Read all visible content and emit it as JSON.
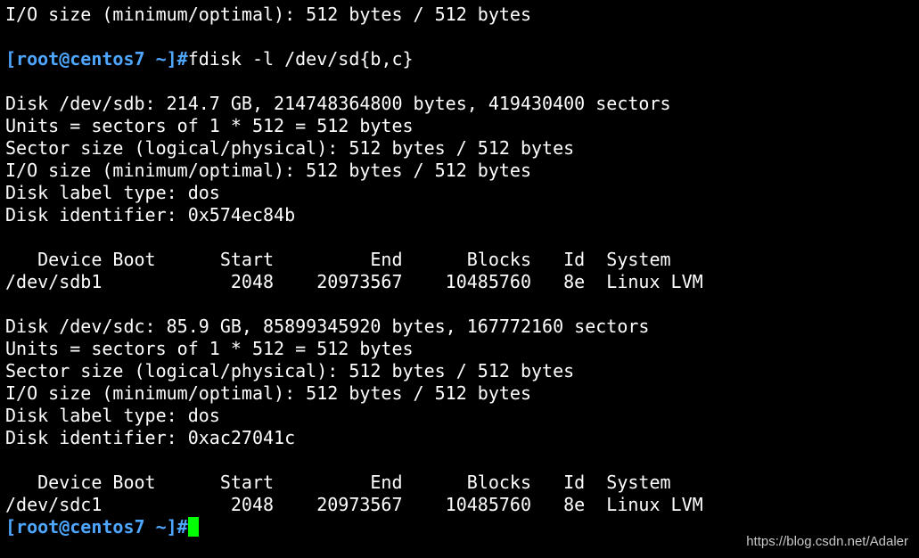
{
  "terminal": {
    "lines": [
      {
        "type": "output",
        "text": "I/O size (minimum/optimal): 512 bytes / 512 bytes"
      },
      {
        "type": "blank",
        "text": ""
      },
      {
        "type": "prompt",
        "prompt": "[root@centos7 ~]#",
        "command": "fdisk -l /dev/sd{b,c}"
      },
      {
        "type": "blank",
        "text": ""
      },
      {
        "type": "output",
        "text": "Disk /dev/sdb: 214.7 GB, 214748364800 bytes, 419430400 sectors"
      },
      {
        "type": "output",
        "text": "Units = sectors of 1 * 512 = 512 bytes"
      },
      {
        "type": "output",
        "text": "Sector size (logical/physical): 512 bytes / 512 bytes"
      },
      {
        "type": "output",
        "text": "I/O size (minimum/optimal): 512 bytes / 512 bytes"
      },
      {
        "type": "output",
        "text": "Disk label type: dos"
      },
      {
        "type": "output",
        "text": "Disk identifier: 0x574ec84b"
      },
      {
        "type": "blank",
        "text": ""
      },
      {
        "type": "output",
        "text": "   Device Boot      Start         End      Blocks   Id  System"
      },
      {
        "type": "output",
        "text": "/dev/sdb1            2048    20973567    10485760   8e  Linux LVM"
      },
      {
        "type": "blank",
        "text": ""
      },
      {
        "type": "output",
        "text": "Disk /dev/sdc: 85.9 GB, 85899345920 bytes, 167772160 sectors"
      },
      {
        "type": "output",
        "text": "Units = sectors of 1 * 512 = 512 bytes"
      },
      {
        "type": "output",
        "text": "Sector size (logical/physical): 512 bytes / 512 bytes"
      },
      {
        "type": "output",
        "text": "I/O size (minimum/optimal): 512 bytes / 512 bytes"
      },
      {
        "type": "output",
        "text": "Disk label type: dos"
      },
      {
        "type": "output",
        "text": "Disk identifier: 0xac27041c"
      },
      {
        "type": "blank",
        "text": ""
      },
      {
        "type": "output",
        "text": "   Device Boot      Start         End      Blocks   Id  System"
      },
      {
        "type": "output",
        "text": "/dev/sdc1            2048    20973567    10485760   8e  Linux LVM"
      },
      {
        "type": "prompt",
        "prompt": "[root@centos7 ~]#",
        "command": "",
        "cursor": true
      }
    ],
    "colors": {
      "background": "#000000",
      "text": "#ffffff",
      "prompt": "#4ea6ff",
      "cursor": "#00ff00"
    }
  },
  "watermark": {
    "text": "https://blog.csdn.net/Adaler"
  }
}
